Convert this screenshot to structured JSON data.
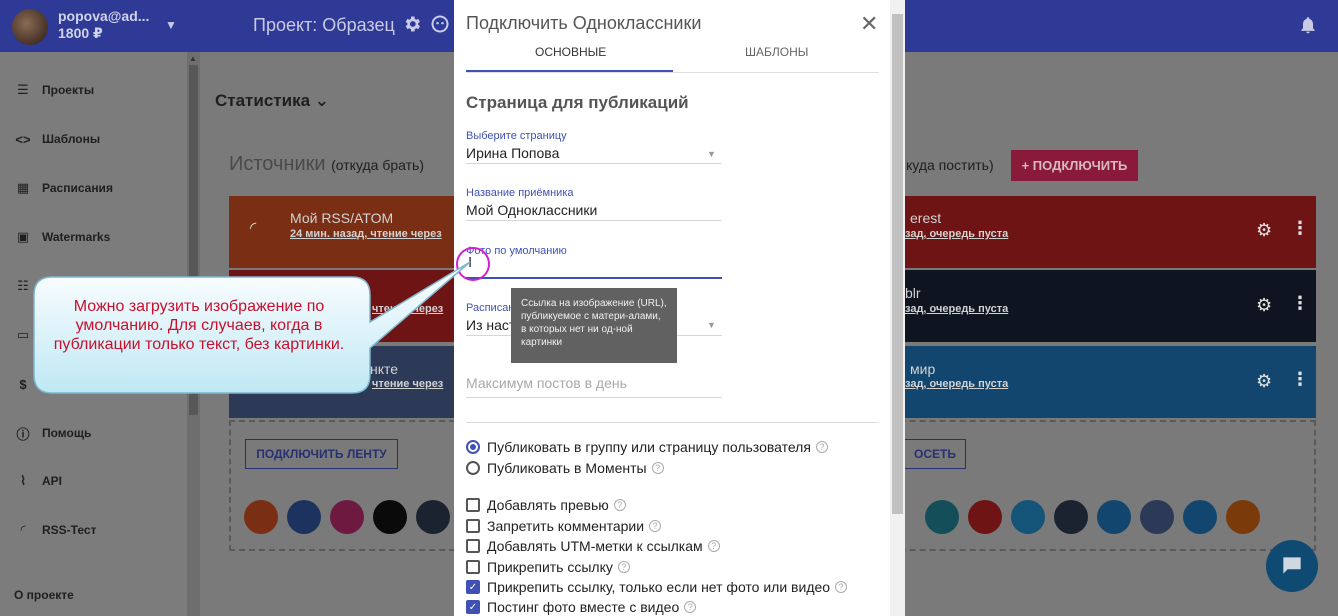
{
  "header": {
    "user_email": "popova@ad...",
    "balance": "1800 ₽",
    "project": "Проект: Образец"
  },
  "sidebar": {
    "items": [
      {
        "label": "Проекты",
        "icon": "list-icon"
      },
      {
        "label": "Шаблоны",
        "icon": "code-icon"
      },
      {
        "label": "Расписания",
        "icon": "calendar-icon"
      },
      {
        "label": "Watermarks",
        "icon": "image-icon"
      },
      {
        "label": "",
        "icon": "sliders-icon"
      },
      {
        "label": "",
        "icon": "card-icon"
      },
      {
        "label": "",
        "icon": "dollar-icon"
      },
      {
        "label": "Помощь",
        "icon": "help-icon"
      },
      {
        "label": "API",
        "icon": "api-icon"
      },
      {
        "label": "RSS-Тест",
        "icon": "rss-icon"
      }
    ],
    "about": "О проекте"
  },
  "main": {
    "stats": "Статистика",
    "sources_title": "Источники",
    "sources_sub": "(откуда брать)",
    "dest_tail": "куда постить)",
    "connect_button": "+ ПОДКЛЮЧИТЬ",
    "source_cards": [
      {
        "title": "Мой RSS/ATOM",
        "sub": "24 мин. назад, чтение через",
        "color": "#7a2e13"
      },
      {
        "title": "",
        "sub": "чтение через",
        "color": "#6e1414"
      },
      {
        "title": "нкте",
        "sub": "чтение через",
        "color": "#2c3a57"
      }
    ],
    "dest_cards": [
      {
        "title": "erest",
        "sub": "зад, очередь пуста",
        "color": "#6e1414"
      },
      {
        "title": "blr",
        "sub": "зад, очередь пуста",
        "color": "#0e1520"
      },
      {
        "title": "мир",
        "sub": "зад, очередь пуста",
        "color": "#12466e"
      }
    ],
    "connect_feed": "ПОДКЛЮЧИТЬ ЛЕНТУ",
    "create_tail": "ОСЕТЬ"
  },
  "modal": {
    "title": "Подключить Одноклассники",
    "tabs": [
      "ОСНОВНЫЕ",
      "ШАБЛОНЫ"
    ],
    "section": "Страница для публикаций",
    "page_label": "Выберите страницу",
    "page_value": "Ирина Попова",
    "name_label": "Название приёмника",
    "name_value": "Мой Одноклассники",
    "photo_label": "Фото по умолчанию",
    "schedule_label": "Расписан",
    "schedule_value": "Из наст",
    "max_posts_placeholder": "Максимум постов в день",
    "radios": [
      {
        "label": "Публиковать в группу или страницу пользователя",
        "checked": true
      },
      {
        "label": "Публиковать в Моменты",
        "checked": false
      }
    ],
    "checkboxes": [
      {
        "label": "Добавлять превью",
        "checked": false
      },
      {
        "label": "Запретить комментарии",
        "checked": false
      },
      {
        "label": "Добавлять UTM-метки к ссылкам",
        "checked": false
      },
      {
        "label": "Прикрепить ссылку",
        "checked": false
      },
      {
        "label": "Прикрепить ссылку, только если нет фото или видео",
        "checked": true
      },
      {
        "label": "Постинг фото вместе с видео",
        "checked": true
      }
    ],
    "help_glyph": "?",
    "tooltip": "Ссылка на изображение (URL), публикуемое с матери-алами, в которых нет ни од-ной картинки"
  },
  "callout": "Можно загрузить изображение по умолчанию. Для случаев, когда в публикации только текст, без картинки."
}
